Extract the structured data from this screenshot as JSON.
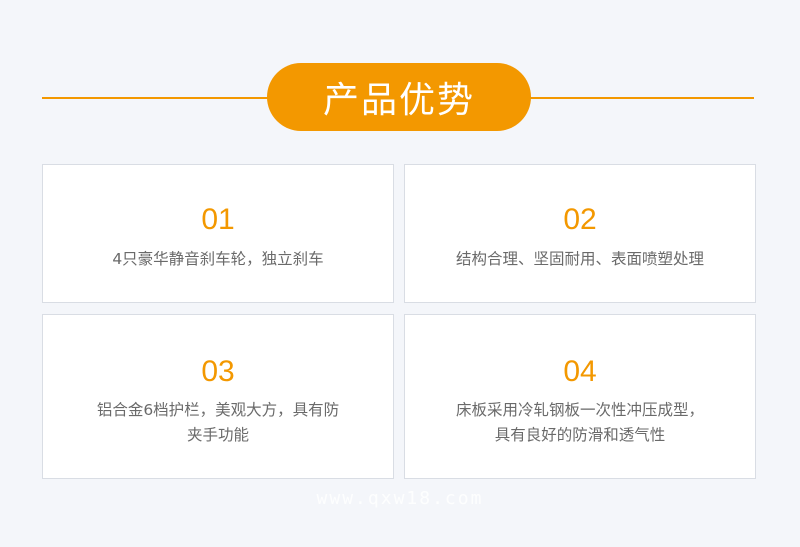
{
  "header": {
    "title": "产品优势"
  },
  "features": [
    {
      "number": "01",
      "lines": [
        "4只豪华静音刹车轮，独立刹车"
      ]
    },
    {
      "number": "02",
      "lines": [
        "结构合理、坚固耐用、表面喷塑处理"
      ]
    },
    {
      "number": "03",
      "lines": [
        "铝合金6档护栏，美观大方，具有防",
        "夹手功能"
      ]
    },
    {
      "number": "04",
      "lines": [
        "床板采用冷轧钢板一次性冲压成型，",
        "具有良好的防滑和透气性"
      ]
    }
  ],
  "watermark": "www.qxw18.com",
  "colors": {
    "accent": "#f39800",
    "background": "#f4f6fa",
    "text": "#6a6a6a"
  }
}
